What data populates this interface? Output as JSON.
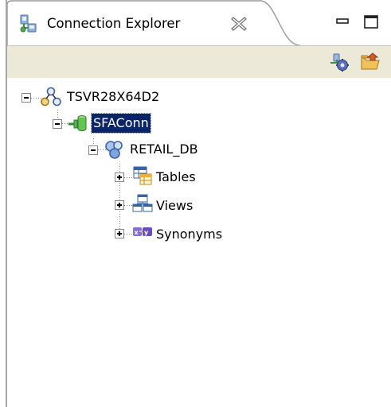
{
  "view": {
    "title": "Connection Explorer",
    "icons": {
      "view": "connection-explorer-icon",
      "close": "close-x-icon",
      "minimize": "minimize-icon",
      "maximize": "maximize-icon"
    }
  },
  "toolbar": {
    "items": [
      {
        "name": "connect",
        "icon": "connect-gear-icon"
      },
      {
        "name": "open",
        "icon": "open-folder-icon"
      }
    ]
  },
  "tree": {
    "server": {
      "label": "TSVR28X64D2",
      "icon": "server-network-icon",
      "expanded": true
    },
    "connection": {
      "label": "SFAConn",
      "icon": "database-connection-icon",
      "expanded": true,
      "selected": true
    },
    "database": {
      "label": "RETAIL_DB",
      "icon": "database-icon",
      "expanded": true
    },
    "children": [
      {
        "label": "Tables",
        "icon": "table-icon",
        "expanded": false
      },
      {
        "label": "Views",
        "icon": "view-icon",
        "expanded": false
      },
      {
        "label": "Synonyms",
        "icon": "synonym-icon",
        "expanded": false
      }
    ]
  },
  "colors": {
    "selection_bg": "#0a246a",
    "toolbar_bg": "#ece9d8"
  }
}
